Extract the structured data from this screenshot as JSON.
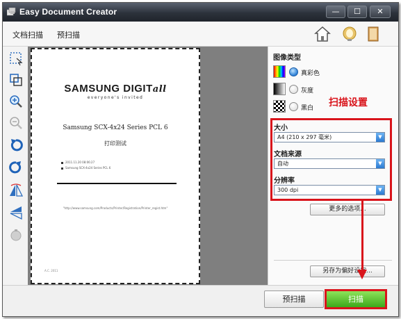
{
  "window": {
    "title": "Easy Document Creator",
    "controls": {
      "minimize": "—",
      "maximize": "☐",
      "close": "✕"
    }
  },
  "toolbar": {
    "tabs": [
      {
        "label": "文档扫描"
      },
      {
        "label": "预扫描"
      }
    ],
    "icons": [
      "home-icon",
      "tip-icon",
      "book-icon"
    ]
  },
  "tools": [
    "marquee-select-icon",
    "crop-icon",
    "zoom-in-icon",
    "zoom-out-icon",
    "rotate-left-icon",
    "rotate-right-icon",
    "flip-horizontal-icon",
    "flip-vertical-icon",
    "clear-icon"
  ],
  "preview": {
    "logo": "SAMSUNG DIGIT",
    "logo_tail": "all",
    "logo_tagline": "everyone's invited",
    "doc_title": "Samsung SCX-4x24 Series PCL 6",
    "doc_subtitle": "打印测试",
    "info_lines": [
      "2011.11.20 08:06:27",
      "Samsung SCX-4x24 Series PCL 6"
    ],
    "url": "\"http://www.samsung.com/Products/Printer/Registration/Printer_regist.htm\"",
    "footer": "A.C. 2011"
  },
  "panel": {
    "image_type_title": "图像类型",
    "image_types": [
      {
        "label": "真彩色",
        "selected": true
      },
      {
        "label": "灰度",
        "selected": false
      },
      {
        "label": "黑白",
        "selected": false
      }
    ],
    "annotation_label": "扫描设置",
    "size_label": "大小",
    "size_value": "A4 (210 x 297 毫米)",
    "source_label": "文档来源",
    "source_value": "自动",
    "resolution_label": "分辨率",
    "resolution_value": "300 dpi",
    "more_options": "更多的选项...",
    "save_preference": "另存为偏好设定..."
  },
  "bottom": {
    "prescan_label": "预扫描",
    "scan_label": "扫描"
  },
  "colors": {
    "annotation": "#d9141b",
    "scan_button": "#4cb82a",
    "radio_selected": "#2c7fd6"
  }
}
